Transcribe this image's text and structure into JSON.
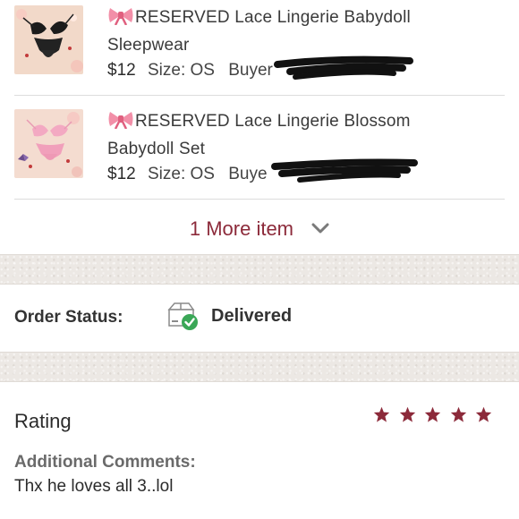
{
  "items": [
    {
      "title_lines": [
        "RESERVED Lace Lingerie Babydoll",
        "Sleepwear"
      ],
      "price": "$12",
      "size": "Size: OS",
      "buyer_partial": "Buyer",
      "thumb": "black-lace-lingerie-photo"
    },
    {
      "title_lines": [
        "RESERVED Lace Lingerie Blossom",
        "Babydoll Set"
      ],
      "price": "$12",
      "size": "Size: OS",
      "buyer_partial": "Buye",
      "thumb": "pink-lace-lingerie-photo"
    }
  ],
  "more_items_label": "1 More item",
  "order_status": {
    "label": "Order Status:",
    "value": "Delivered",
    "icon": "box-delivered-check-icon"
  },
  "rating": {
    "title": "Rating",
    "stars": 5,
    "max_stars": 5,
    "star_color": "#8c2a3a"
  },
  "comments": {
    "label": "Additional Comments:",
    "text": "Thx he loves all 3..lol"
  },
  "colors": {
    "accent": "#8c2a3a",
    "check_green": "#3aa757",
    "divider": "#dcdcdc"
  }
}
